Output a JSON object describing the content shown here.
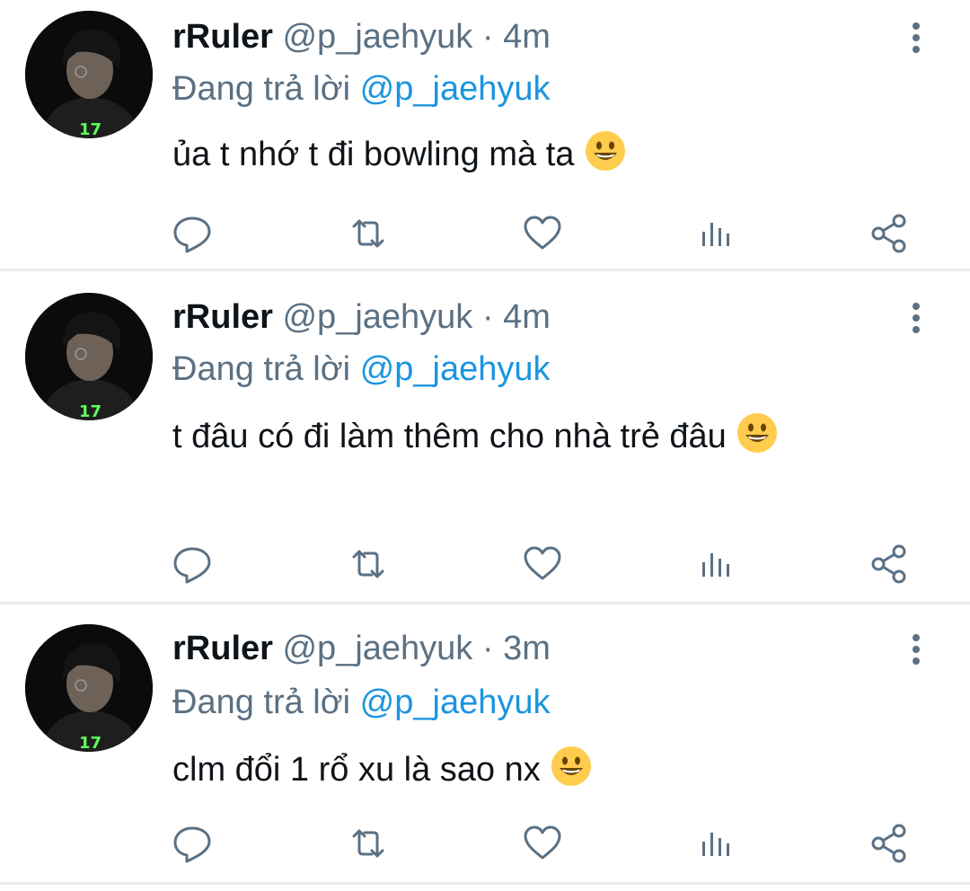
{
  "tweets": [
    {
      "name": "rRuler",
      "handle": "@p_jaehyuk",
      "separator": "·",
      "time": "4m",
      "reply_prefix": "Đang trả lời",
      "reply_mention": "@p_jaehyuk",
      "text": "ủa t nhớ t đi bowling mà ta",
      "emoji": "grinning-face"
    },
    {
      "name": "rRuler",
      "handle": "@p_jaehyuk",
      "separator": "·",
      "time": "4m",
      "reply_prefix": "Đang trả lời",
      "reply_mention": "@p_jaehyuk",
      "text": "t đâu có đi làm thêm cho nhà trẻ đâu",
      "emoji": "grinning-face"
    },
    {
      "name": "rRuler",
      "handle": "@p_jaehyuk",
      "separator": "·",
      "time": "3m",
      "reply_prefix": "Đang trả lời",
      "reply_mention": "@p_jaehyuk",
      "text": "clm đổi 1 rổ xu là sao nx",
      "emoji": "grinning-face"
    }
  ],
  "actions": [
    "reply-icon",
    "retweet-icon",
    "like-icon",
    "analytics-icon",
    "share-icon"
  ],
  "icons": {
    "more": "more-vertical-icon"
  },
  "colors": {
    "name": "#0f1419",
    "secondary": "#5b7083",
    "mention": "#1b95e0",
    "divider": "#e6ecf0",
    "icon": "#5b7083"
  }
}
